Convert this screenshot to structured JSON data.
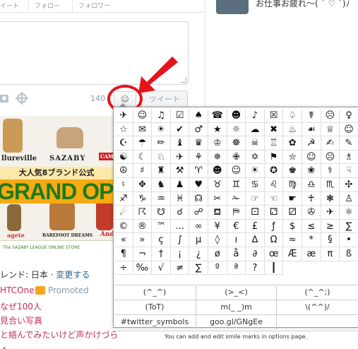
{
  "profile_tabs": [
    "イート",
    "フォロー",
    "フォロワー"
  ],
  "compose": {
    "char_count": "140",
    "smiley_label": "☺",
    "tweet_label": "ツイート"
  },
  "ad": {
    "brands": [
      "llureville",
      "SAZABY",
      "CAMPE"
    ],
    "headline": "大人気8ブランド公式",
    "big_text": "GRAND OPEN",
    "labels": [
      "agete",
      "BAREFOOT DREAMS",
      "And"
    ],
    "footer": "The SAZABY LEAGUE ONLINE STORE"
  },
  "trends": {
    "title": "レンド: 日本 · ",
    "change": "変更する",
    "items": [
      "HTCOne",
      "なぜ100人",
      "見合い写真",
      "と絡んでみたいけど声かけづら"
    ],
    "promoted": "Promoted"
  },
  "right": {
    "tweet_text": "お仕事お疲れ～( ´ ♡ `)ﾉ"
  },
  "symbols": [
    "✈",
    "☺",
    "♫",
    "☑",
    "♠",
    "☎",
    "☻",
    "♪",
    "☒",
    "♤",
    "☤",
    "☹",
    "♀",
    "☆",
    "✉",
    "☀",
    "✔",
    "♂",
    "★",
    "☼",
    "☁",
    "✖",
    "♨",
    "☙",
    "♕",
    "☺",
    "☪",
    "☂",
    "✏",
    "♝",
    "♛",
    "♔",
    "☸",
    "☠",
    "♖",
    "✿",
    "☭",
    "✍",
    "✎",
    "☯",
    "☾",
    "♘",
    "✈",
    "⚘",
    "✵",
    "✙",
    "✡",
    "⚑",
    "⛦",
    "☺",
    "☹",
    "♗",
    "☮",
    "♯",
    "♜",
    "⚒",
    "♈",
    "☻",
    "☺",
    "☀",
    "✪",
    "♚",
    "❀",
    "⚕",
    "☟",
    "♮",
    "✥",
    "♞",
    "♟",
    "♥",
    "♉",
    "♊",
    "♋",
    "♌",
    "♍",
    "♎",
    "♏",
    "✣",
    "♐",
    "♑",
    "♒",
    "♓",
    "☊",
    "✂",
    "✁",
    "☞",
    "☜",
    "☛",
    "♰",
    "❃",
    "♙",
    "☄",
    "☈",
    "☋",
    "☌",
    "☍",
    "⛾",
    "⛿",
    "⚀",
    "⚁",
    "⚂",
    "✇",
    "✈",
    "⚛",
    "©",
    "®",
    "™",
    "…",
    "∞",
    "¥",
    "€",
    "£",
    "ƒ",
    "$",
    "≤",
    "≥",
    "∑",
    "«",
    "»",
    "ç",
    "∫",
    "µ",
    "◊",
    "ı",
    "∆",
    "Ω",
    "≈",
    "*",
    "§",
    "•",
    "¶",
    "¬",
    "†",
    "¡",
    "¿",
    "ø",
    "å",
    "∂",
    "œ",
    "Æ",
    "æ",
    "π",
    "ß",
    "÷",
    "‰",
    "√",
    "≠",
    "∑",
    "º",
    "ª",
    "?",
    "┃"
  ],
  "kaomoji": [
    [
      "(^_^)",
      "(>_<)",
      "(^_^;)"
    ],
    [
      "(ToT)",
      "m(_ _)m",
      "\\(^^)/"
    ],
    [
      "#twitter_symbols",
      "goo.gl/GNgEe"
    ]
  ],
  "options_note": "You can add and edit smile marks in options page.",
  "colors": {
    "accent_red": "#e4141c",
    "link_blue": "#2a6496",
    "trend_pink": "#ca2b56",
    "ad_orange": "#f6ab12",
    "ad_green": "#1e7a1e"
  }
}
